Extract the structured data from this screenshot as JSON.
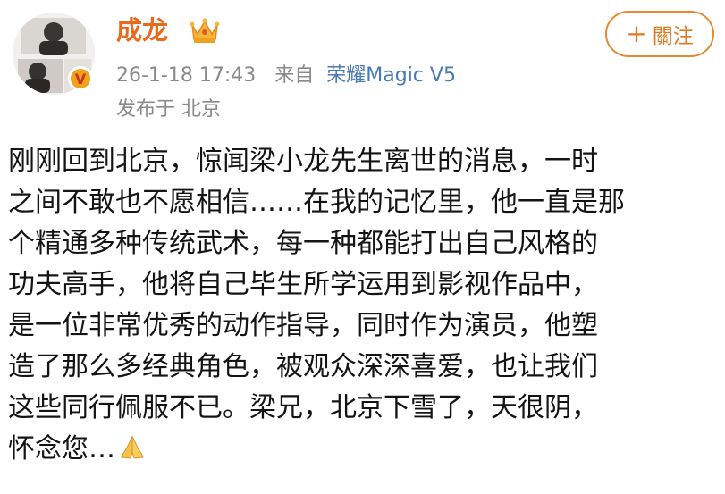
{
  "user": {
    "name": "成龙",
    "verified_badge": "V",
    "crown_icon": "crown-icon",
    "avatar_icon": "avatar-photo"
  },
  "meta": {
    "time": "26-1-18 17:43",
    "from_label": "来自",
    "device": "荣耀Magic V5",
    "location": "发布于 北京"
  },
  "follow": {
    "plus": "+",
    "label": "關注"
  },
  "post": {
    "lines": [
      "刚刚回到北京，惊闻梁小龙先生离世的消息，一时",
      "之间不敢也不愿相信……在我的记忆里，他一直是那",
      "个精通多种传统武术，每一种都能打出自己风格的",
      "功夫高手，他将自己毕生所学运用到影视作品中，",
      "是一位非常优秀的动作指导，同时作为演员，他塑",
      "造了那么多经典角色，被观众深深喜爱，也让我们",
      "这些同行佩服不已。梁兄，北京下雪了，天很阴，",
      "怀念您…"
    ],
    "end_emoji": "praying-hands-icon"
  },
  "colors": {
    "username": "#e86a1d",
    "device_link": "#4a7ab4",
    "meta_gray": "#8a8a8a",
    "follow_border": "#e8892f",
    "badge": "#f1a11a"
  }
}
